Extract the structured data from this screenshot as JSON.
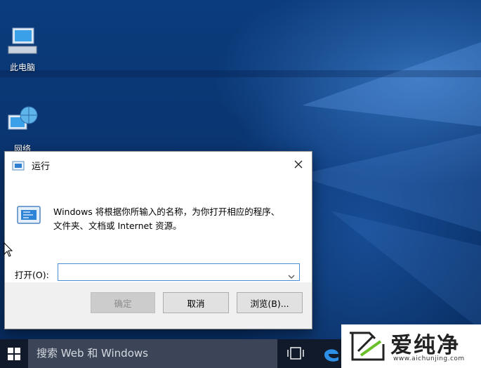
{
  "desktop": {
    "icons": [
      {
        "label": "此电脑"
      },
      {
        "label": "网络"
      }
    ]
  },
  "run_dialog": {
    "title": "运行",
    "description_line1": "Windows 将根据你所输入的名称，为你打开相应的程序、",
    "description_line2": "文件夹、文档或 Internet 资源。",
    "open_label": "打开(O):",
    "input_value": "",
    "buttons": {
      "ok": "确定",
      "cancel": "取消",
      "browse": "浏览(B)..."
    }
  },
  "taskbar": {
    "search_placeholder": "搜索 Web 和 Windows"
  },
  "watermark": {
    "text": "爱纯净",
    "subtext": "www.aichunjing.com"
  },
  "colors": {
    "accent": "#0078d7",
    "taskbar": "#101a2a"
  }
}
